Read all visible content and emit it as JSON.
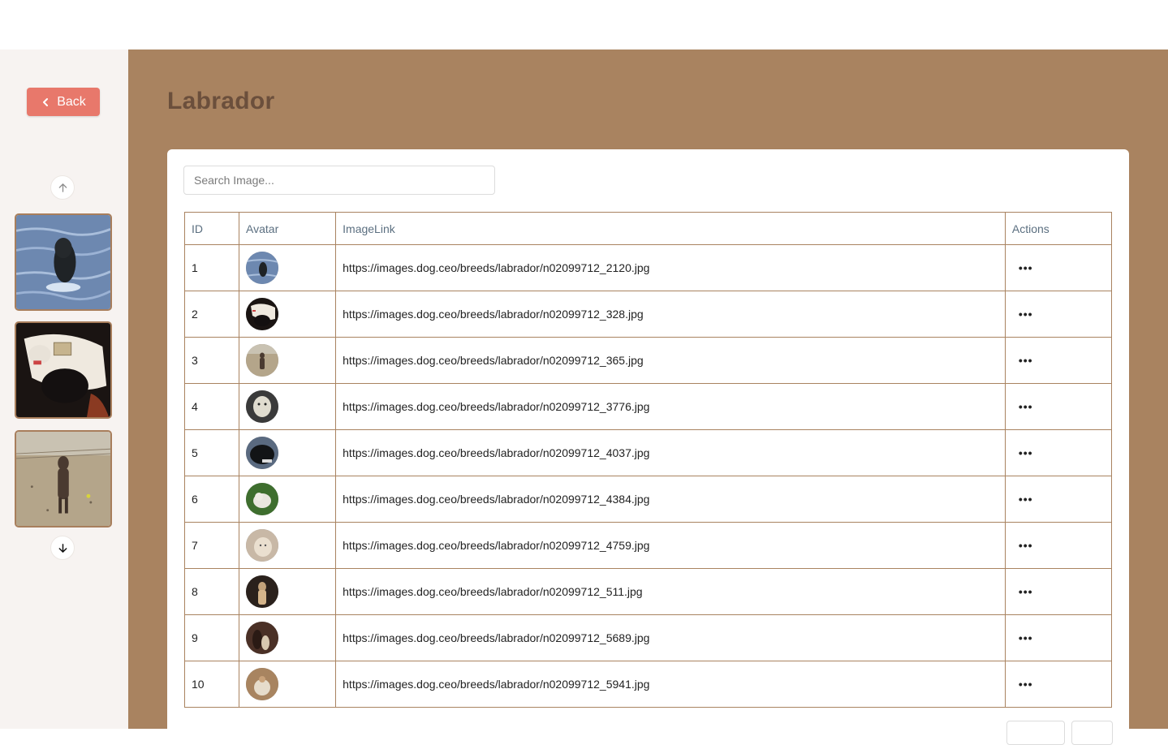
{
  "sidebar": {
    "back_label": "Back",
    "scroll_up_icon": "arrow-up-icon",
    "scroll_down_icon": "arrow-down-icon",
    "thumbnails": [
      {
        "kind": "dog-in-water"
      },
      {
        "kind": "dog-on-blanket"
      },
      {
        "kind": "dog-in-yard"
      }
    ]
  },
  "page": {
    "title": "Labrador"
  },
  "search": {
    "placeholder": "Search Image..."
  },
  "table": {
    "headers": {
      "id": "ID",
      "avatar": "Avatar",
      "link": "ImageLink",
      "actions": "Actions"
    },
    "rows": [
      {
        "id": "1",
        "link": "https://images.dog.ceo/breeds/labrador/n02099712_2120.jpg"
      },
      {
        "id": "2",
        "link": "https://images.dog.ceo/breeds/labrador/n02099712_328.jpg"
      },
      {
        "id": "3",
        "link": "https://images.dog.ceo/breeds/labrador/n02099712_365.jpg"
      },
      {
        "id": "4",
        "link": "https://images.dog.ceo/breeds/labrador/n02099712_3776.jpg"
      },
      {
        "id": "5",
        "link": "https://images.dog.ceo/breeds/labrador/n02099712_4037.jpg"
      },
      {
        "id": "6",
        "link": "https://images.dog.ceo/breeds/labrador/n02099712_4384.jpg"
      },
      {
        "id": "7",
        "link": "https://images.dog.ceo/breeds/labrador/n02099712_4759.jpg"
      },
      {
        "id": "8",
        "link": "https://images.dog.ceo/breeds/labrador/n02099712_511.jpg"
      },
      {
        "id": "9",
        "link": "https://images.dog.ceo/breeds/labrador/n02099712_5689.jpg"
      },
      {
        "id": "10",
        "link": "https://images.dog.ceo/breeds/labrador/n02099712_5941.jpg"
      }
    ],
    "actions_icon": "more-horizontal-icon",
    "actions_glyph": "•••"
  },
  "colors": {
    "main_bg": "#a98360",
    "sidebar_bg": "#f7f3f1",
    "back_button": "#e8786b",
    "title": "#6b4f3c",
    "table_border": "#a98360"
  }
}
